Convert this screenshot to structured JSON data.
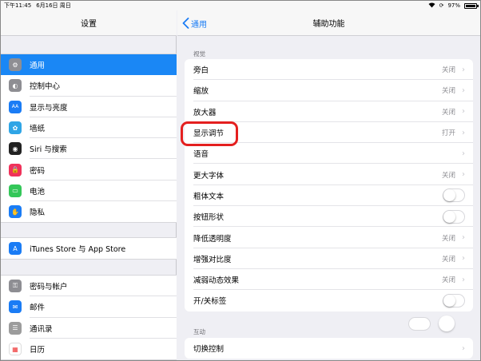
{
  "status_bar": {
    "time": "下午11:45",
    "date": "6月16日 周日",
    "battery": "97%",
    "battery_level": 0.97
  },
  "left": {
    "title": "设置",
    "groups": [
      [
        {
          "label": "通用",
          "icon": "gear-icon",
          "color": "#8e8e93",
          "selected": true
        },
        {
          "label": "控制中心",
          "icon": "toggles-icon",
          "color": "#8e8e93"
        },
        {
          "label": "显示与亮度",
          "icon": "text-size-icon",
          "color": "#1a7cf5"
        },
        {
          "label": "墙纸",
          "icon": "flower-icon",
          "color": "#2fa5e6"
        },
        {
          "label": "Siri 与搜索",
          "icon": "siri-icon",
          "color": "#222"
        },
        {
          "label": "密码",
          "icon": "lock-icon",
          "color": "#f0325a"
        },
        {
          "label": "电池",
          "icon": "battery-icon",
          "color": "#34c759"
        },
        {
          "label": "隐私",
          "icon": "hand-icon",
          "color": "#1a7cf5"
        }
      ],
      [
        {
          "label": "iTunes Store 与 App Store",
          "icon": "app-store-icon",
          "color": "#1a7cf5"
        }
      ],
      [
        {
          "label": "密码与帐户",
          "icon": "key-icon",
          "color": "#8e8e93"
        },
        {
          "label": "邮件",
          "icon": "mail-icon",
          "color": "#1a7cf5"
        },
        {
          "label": "通讯录",
          "icon": "contacts-icon",
          "color": "#9c9c9c"
        },
        {
          "label": "日历",
          "icon": "calendar-icon",
          "color": "#ffffff"
        }
      ]
    ]
  },
  "right": {
    "back_label": "通用",
    "title": "辅助功能",
    "section_vision": "视觉",
    "vision_rows": [
      {
        "label": "旁白",
        "value": "关闭",
        "kind": "chevron"
      },
      {
        "label": "缩放",
        "value": "关闭",
        "kind": "chevron"
      },
      {
        "label": "放大器",
        "value": "关闭",
        "kind": "chevron"
      },
      {
        "label": "显示调节",
        "value": "打开",
        "kind": "chevron"
      },
      {
        "label": "语音",
        "value": "",
        "kind": "chevron"
      },
      {
        "label": "更大字体",
        "value": "关闭",
        "kind": "chevron"
      },
      {
        "label": "粗体文本",
        "value": "",
        "kind": "toggle"
      },
      {
        "label": "按钮形状",
        "value": "",
        "kind": "toggle"
      },
      {
        "label": "降低透明度",
        "value": "关闭",
        "kind": "chevron"
      },
      {
        "label": "增强对比度",
        "value": "关闭",
        "kind": "chevron"
      },
      {
        "label": "减弱动态效果",
        "value": "关闭",
        "kind": "chevron"
      },
      {
        "label": "开/关标签",
        "value": "",
        "kind": "toggle"
      }
    ],
    "section_interaction": "互动",
    "interaction_rows": [
      {
        "label": "切换控制",
        "value": "",
        "kind": "chevron"
      }
    ]
  },
  "colors": {
    "accent": "#1a7cf5",
    "highlight": "#e41f1f"
  }
}
